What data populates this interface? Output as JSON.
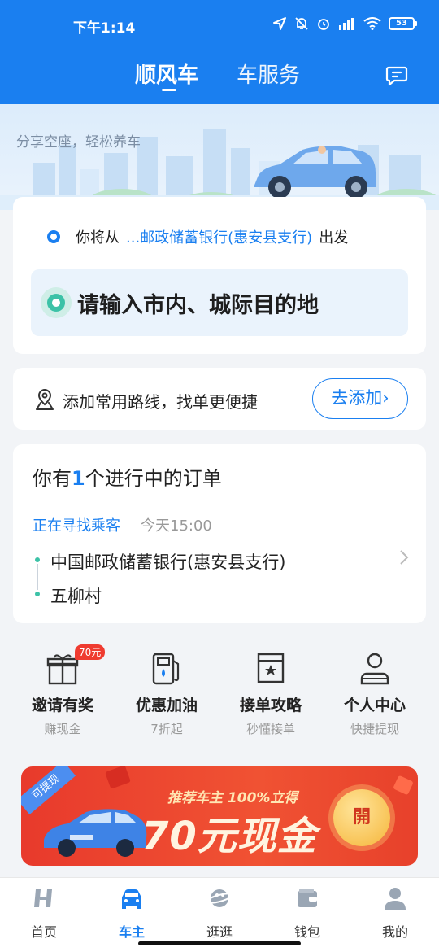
{
  "status_bar": {
    "time": "下午1:14",
    "battery": "53"
  },
  "header": {
    "tabs": [
      {
        "label": "顺风车",
        "active": true
      },
      {
        "label": "车服务",
        "active": false
      }
    ]
  },
  "banner": {
    "slogan": "分享空座，轻松养车"
  },
  "departure": {
    "prefix": "你将从",
    "place": "...邮政储蓄银行(惠安县支行)",
    "suffix": "出发",
    "destination_placeholder": "请输入市内、城际目的地"
  },
  "route_card": {
    "text": "添加常用路线，找单更便捷",
    "button": "去添加",
    "button_chevron": "›"
  },
  "order": {
    "title_prefix": "你有",
    "count": "1",
    "title_suffix": "个进行中的订单",
    "status": "正在寻找乘客",
    "time": "今天15:00",
    "from": "中国邮政储蓄银行(惠安县支行)",
    "to": "五柳村"
  },
  "actions": [
    {
      "label": "邀请有奖",
      "sub": "赚现金",
      "badge": "70元",
      "icon": "gift-icon"
    },
    {
      "label": "优惠加油",
      "sub": "7折起",
      "icon": "fuel-pump-icon"
    },
    {
      "label": "接单攻略",
      "sub": "秒懂接单",
      "icon": "star-bookmark-icon"
    },
    {
      "label": "个人中心",
      "sub": "快捷提现",
      "icon": "person-icon"
    }
  ],
  "promo": {
    "corner": "可提现",
    "subtitle": "推荐车主 100%立得",
    "headline": "70元现金",
    "button": "開"
  },
  "bottom_nav": [
    {
      "label": "首页",
      "icon": "home-logo-icon",
      "active": false
    },
    {
      "label": "车主",
      "icon": "car-icon",
      "active": true
    },
    {
      "label": "逛逛",
      "icon": "planet-icon",
      "active": false
    },
    {
      "label": "钱包",
      "icon": "wallet-icon",
      "active": false
    },
    {
      "label": "我的",
      "icon": "profile-icon",
      "active": false
    }
  ],
  "colors": {
    "primary": "#1a7ff0",
    "accent_green": "#3cc2a7",
    "promo_red": "#e83a2c"
  }
}
